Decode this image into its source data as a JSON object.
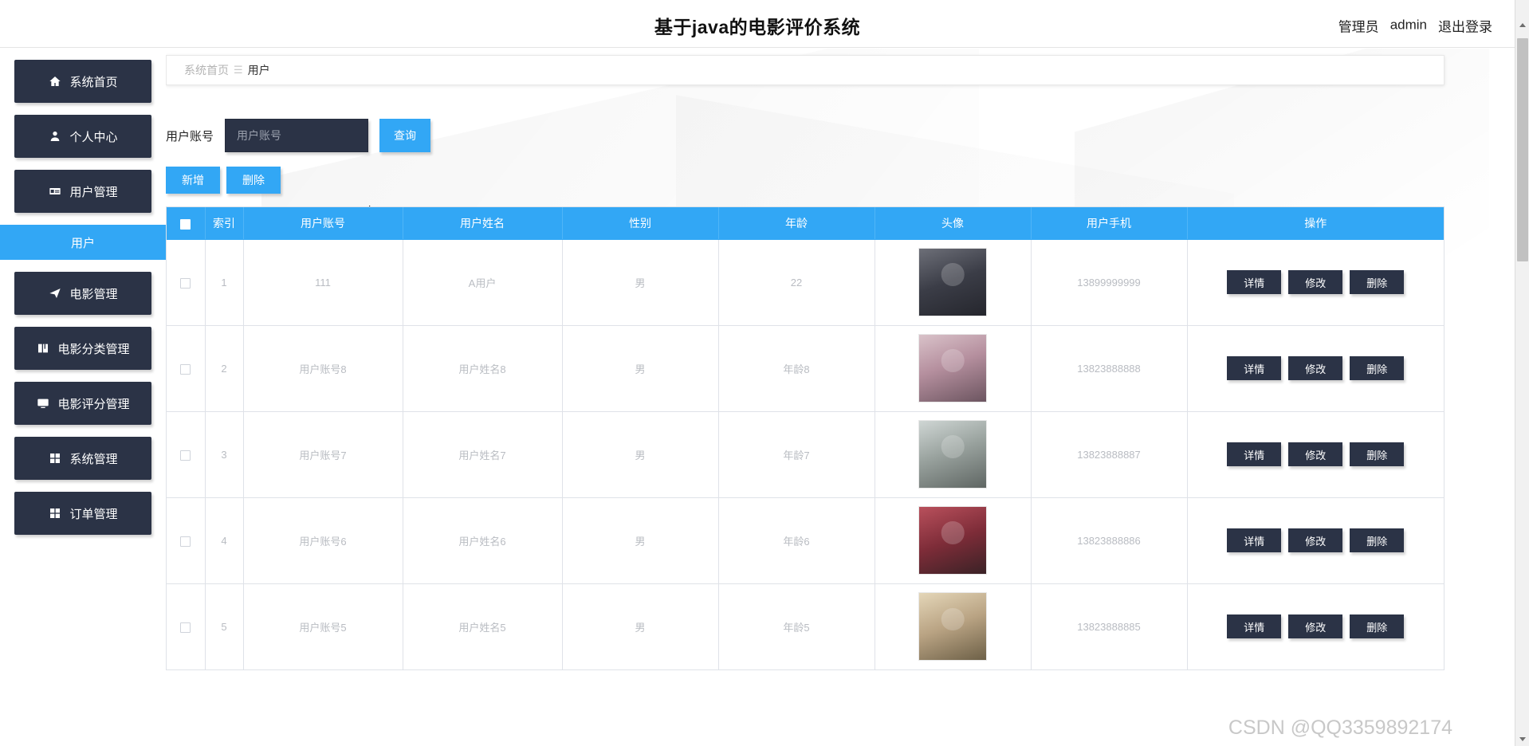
{
  "header": {
    "title": "基于java的电影评价系统",
    "role_label": "管理员",
    "username": "admin",
    "logout_label": "退出登录"
  },
  "sidebar": {
    "items": [
      {
        "label": "系统首页",
        "icon": "home-icon",
        "active": false
      },
      {
        "label": "个人中心",
        "icon": "user-icon",
        "active": false
      },
      {
        "label": "用户管理",
        "icon": "id-card-icon",
        "active": false
      },
      {
        "label": "用户",
        "icon": "none",
        "active": true,
        "sub": true
      },
      {
        "label": "电影管理",
        "icon": "send-icon",
        "active": false
      },
      {
        "label": "电影分类管理",
        "icon": "book-icon",
        "active": false
      },
      {
        "label": "电影评分管理",
        "icon": "monitor-icon",
        "active": false
      },
      {
        "label": "系统管理",
        "icon": "grid-icon",
        "active": false
      },
      {
        "label": "订单管理",
        "icon": "grid-icon",
        "active": false
      }
    ]
  },
  "breadcrumb": {
    "root": "系统首页",
    "separator": "☰",
    "current": "用户"
  },
  "search": {
    "label": "用户账号",
    "placeholder": "用户账号",
    "value": "",
    "query_label": "查询"
  },
  "toolbar": {
    "add_label": "新增",
    "delete_label": "删除"
  },
  "table": {
    "columns": [
      "",
      "索引",
      "用户账号",
      "用户姓名",
      "性别",
      "年龄",
      "头像",
      "用户手机",
      "操作"
    ],
    "ops": {
      "detail": "详情",
      "edit": "修改",
      "delete": "删除"
    },
    "rows": [
      {
        "index": "1",
        "account": "111",
        "name": "A用户",
        "gender": "男",
        "age": "22",
        "avatar": "avatar-1",
        "phone": "13899999999"
      },
      {
        "index": "2",
        "account": "用户账号8",
        "name": "用户姓名8",
        "gender": "男",
        "age": "年龄8",
        "avatar": "avatar-2",
        "phone": "13823888888"
      },
      {
        "index": "3",
        "account": "用户账号7",
        "name": "用户姓名7",
        "gender": "男",
        "age": "年龄7",
        "avatar": "avatar-3",
        "phone": "13823888887"
      },
      {
        "index": "4",
        "account": "用户账号6",
        "name": "用户姓名6",
        "gender": "男",
        "age": "年龄6",
        "avatar": "avatar-4",
        "phone": "13823888886"
      },
      {
        "index": "5",
        "account": "用户账号5",
        "name": "用户姓名5",
        "gender": "男",
        "age": "年龄5",
        "avatar": "avatar-5",
        "phone": "13823888885"
      }
    ]
  },
  "watermark": "CSDN @QQ3359892174",
  "colors": {
    "accent_blue": "#32a7f5",
    "dark_navy": "#2b3346",
    "text_muted": "#b9bcc2"
  }
}
